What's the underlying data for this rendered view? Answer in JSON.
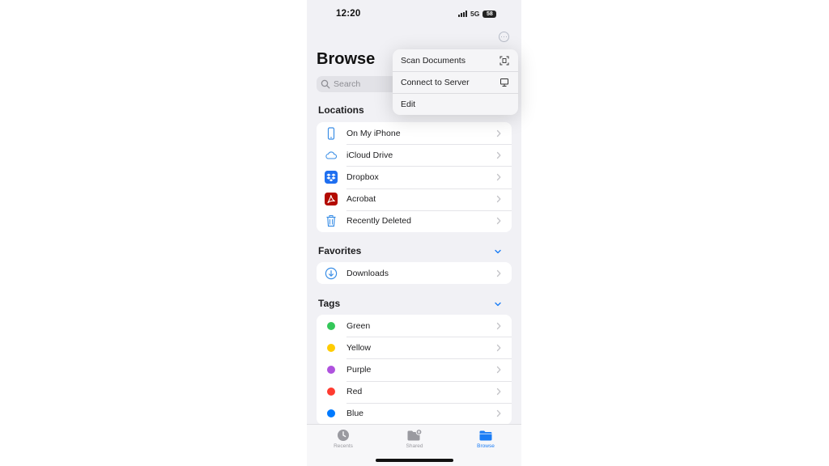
{
  "status": {
    "time": "12:20",
    "network": "5G",
    "battery": "58"
  },
  "header": {
    "title": "Browse"
  },
  "search": {
    "placeholder": "Search"
  },
  "menu": {
    "items": [
      {
        "label": "Scan Documents",
        "icon": "scan-document-icon"
      },
      {
        "label": "Connect to Server",
        "icon": "server-icon"
      },
      {
        "label": "Edit"
      }
    ]
  },
  "locations": {
    "title": "Locations",
    "items": [
      {
        "label": "On My iPhone",
        "icon": "iphone-icon"
      },
      {
        "label": "iCloud Drive",
        "icon": "icloud-icon"
      },
      {
        "label": "Dropbox",
        "icon": "dropbox-icon"
      },
      {
        "label": "Acrobat",
        "icon": "acrobat-icon"
      },
      {
        "label": "Recently Deleted",
        "icon": "trash-icon"
      }
    ]
  },
  "favorites": {
    "title": "Favorites",
    "items": [
      {
        "label": "Downloads",
        "icon": "download-icon"
      }
    ]
  },
  "tags": {
    "title": "Tags",
    "items": [
      {
        "label": "Green",
        "color": "#34c759"
      },
      {
        "label": "Yellow",
        "color": "#ffcc00"
      },
      {
        "label": "Purple",
        "color": "#af52de"
      },
      {
        "label": "Red",
        "color": "#ff3b30"
      },
      {
        "label": "Blue",
        "color": "#007aff"
      }
    ]
  },
  "tabbar": {
    "tabs": [
      {
        "label": "Recents",
        "icon": "clock-icon"
      },
      {
        "label": "Shared",
        "icon": "shared-folder-icon"
      },
      {
        "label": "Browse",
        "icon": "folder-icon",
        "active": true
      }
    ]
  },
  "colors": {
    "accent": "#1a7cf5",
    "tag_green": "#34c759",
    "tag_yellow": "#ffcc00",
    "tag_purple": "#af52de",
    "tag_red": "#ff3b30",
    "tag_blue": "#007aff"
  }
}
